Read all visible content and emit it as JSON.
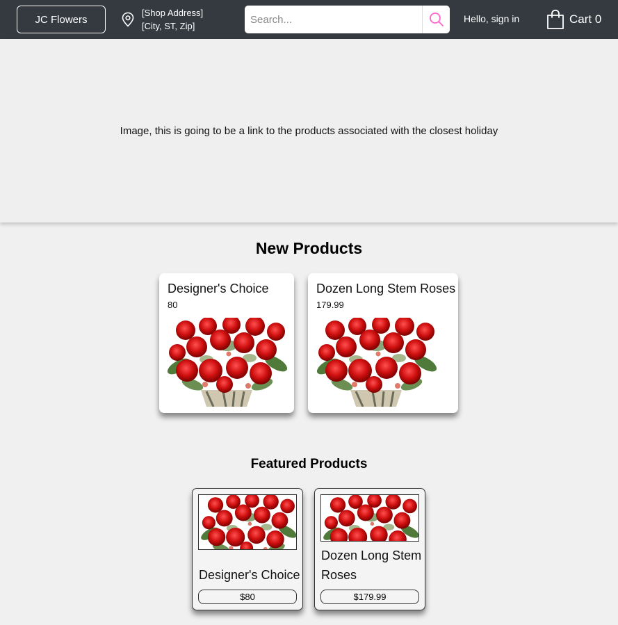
{
  "header": {
    "brand": "JC Flowers",
    "address_line1": "[Shop Address]",
    "address_line2": "[City, ST, Zip]",
    "search_placeholder": "Search...",
    "signin": "Hello, sign in",
    "cart_label": "Cart",
    "cart_count": "0",
    "icons": [
      "location-pin-icon",
      "search-icon",
      "shopping-bag-icon"
    ],
    "search_icon_color": "#ff66cc"
  },
  "hero": {
    "text": "Image, this is going to be a link to the products associated with the closest holiday"
  },
  "new_products": {
    "title": "New Products",
    "items": [
      {
        "name": "Designer's Choice",
        "price": "80"
      },
      {
        "name": "Dozen Long Stem Roses",
        "price": "179.99"
      }
    ]
  },
  "featured_products": {
    "title": "Featured Products",
    "items": [
      {
        "name": "Designer's Choice",
        "price": "$80"
      },
      {
        "name": "Dozen Long Stem Roses",
        "price": "$179.99"
      }
    ]
  },
  "colors": {
    "header_bg": "#343a40",
    "page_bg": "#f0f0f0",
    "rose_red": "#d01010"
  }
}
